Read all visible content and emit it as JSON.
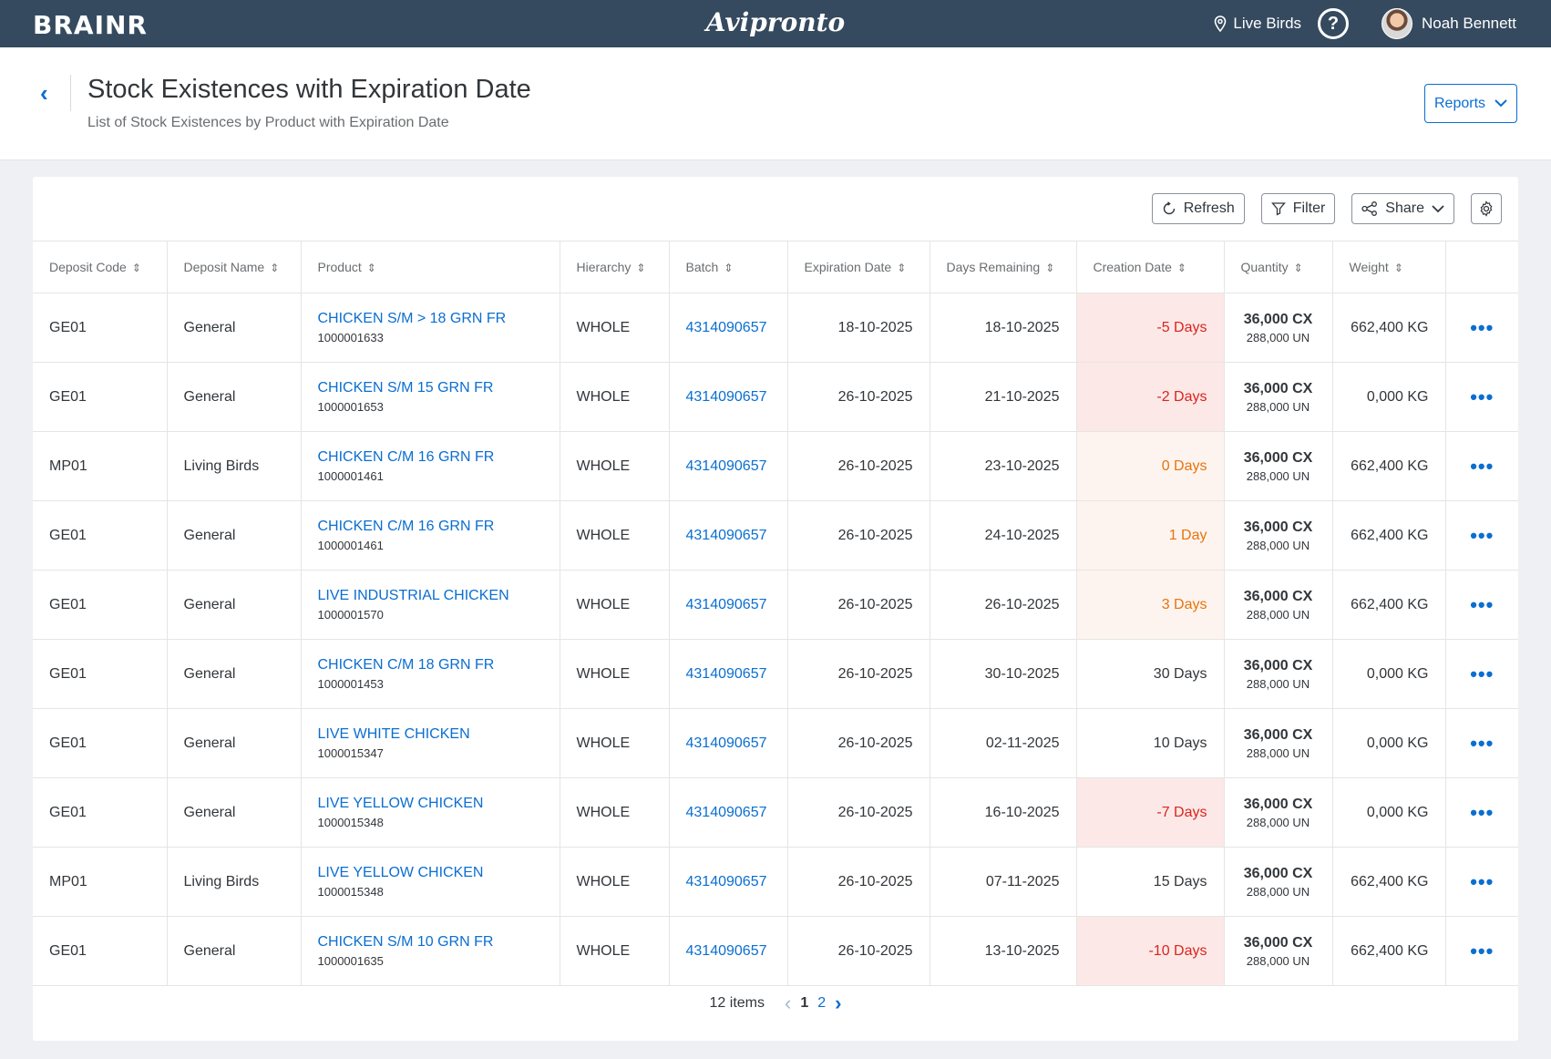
{
  "topbar": {
    "brand": "BRAINR",
    "logo": "Avipronto",
    "location": "Live Birds",
    "help": "?",
    "user_name": "Noah Bennett"
  },
  "header": {
    "back": "‹",
    "title": "Stock Existences with Expiration Date",
    "subtitle": "List of Stock Existences by Product with Expiration Date",
    "reports_label": "Reports"
  },
  "toolbar": {
    "refresh_label": "Refresh",
    "filter_label": "Filter",
    "share_label": "Share"
  },
  "columns": [
    "Deposit Code",
    "Deposit Name",
    "Product",
    "Hierarchy",
    "Batch",
    "Expiration Date",
    "Days Remaining",
    "Creation Date",
    "Quantity",
    "Weight"
  ],
  "rows": [
    {
      "code": "GE01",
      "name": "General",
      "product": "CHICKEN S/M > 18 GRN FR",
      "product_code": "1000001633",
      "hierarchy": "WHOLE",
      "batch": "4314090657",
      "expiration": "18-10-2025",
      "days_remaining": "18-10-2025",
      "creation": "-5 Days",
      "status": "neg",
      "qty": "36,000 CX",
      "qty_un": "288,000 UN",
      "weight": "662,400 KG"
    },
    {
      "code": "GE01",
      "name": "General",
      "product": "CHICKEN S/M 15 GRN FR",
      "product_code": "1000001653",
      "hierarchy": "WHOLE",
      "batch": "4314090657",
      "expiration": "26-10-2025",
      "days_remaining": "21-10-2025",
      "creation": "-2 Days",
      "status": "neg",
      "qty": "36,000 CX",
      "qty_un": "288,000 UN",
      "weight": "0,000 KG"
    },
    {
      "code": "MP01",
      "name": "Living Birds",
      "product": "CHICKEN C/M 16 GRN FR",
      "product_code": "1000001461",
      "hierarchy": "WHOLE",
      "batch": "4314090657",
      "expiration": "26-10-2025",
      "days_remaining": "23-10-2025",
      "creation": "0 Days",
      "status": "warn",
      "qty": "36,000 CX",
      "qty_un": "288,000 UN",
      "weight": "662,400 KG"
    },
    {
      "code": "GE01",
      "name": "General",
      "product": "CHICKEN C/M 16 GRN FR",
      "product_code": "1000001461",
      "hierarchy": "WHOLE",
      "batch": "4314090657",
      "expiration": "26-10-2025",
      "days_remaining": "24-10-2025",
      "creation": "1 Day",
      "status": "warn",
      "qty": "36,000 CX",
      "qty_un": "288,000 UN",
      "weight": "662,400 KG"
    },
    {
      "code": "GE01",
      "name": "General",
      "product": "LIVE INDUSTRIAL CHICKEN",
      "product_code": "1000001570",
      "hierarchy": "WHOLE",
      "batch": "4314090657",
      "expiration": "26-10-2025",
      "days_remaining": "26-10-2025",
      "creation": "3 Days",
      "status": "warn",
      "qty": "36,000 CX",
      "qty_un": "288,000 UN",
      "weight": "662,400 KG"
    },
    {
      "code": "GE01",
      "name": "General",
      "product": "CHICKEN C/M 18 GRN FR",
      "product_code": "1000001453",
      "hierarchy": "WHOLE",
      "batch": "4314090657",
      "expiration": "26-10-2025",
      "days_remaining": "30-10-2025",
      "creation": "30 Days",
      "status": "ok",
      "qty": "36,000 CX",
      "qty_un": "288,000 UN",
      "weight": "0,000 KG"
    },
    {
      "code": "GE01",
      "name": "General",
      "product": "LIVE WHITE CHICKEN",
      "product_code": "1000015347",
      "hierarchy": "WHOLE",
      "batch": "4314090657",
      "expiration": "26-10-2025",
      "days_remaining": "02-11-2025",
      "creation": "10 Days",
      "status": "ok",
      "qty": "36,000 CX",
      "qty_un": "288,000 UN",
      "weight": "0,000 KG"
    },
    {
      "code": "GE01",
      "name": "General",
      "product": "LIVE YELLOW CHICKEN",
      "product_code": "1000015348",
      "hierarchy": "WHOLE",
      "batch": "4314090657",
      "expiration": "26-10-2025",
      "days_remaining": "16-10-2025",
      "creation": "-7 Days",
      "status": "neg",
      "qty": "36,000 CX",
      "qty_un": "288,000 UN",
      "weight": "0,000 KG"
    },
    {
      "code": "MP01",
      "name": "Living Birds",
      "product": "LIVE YELLOW CHICKEN",
      "product_code": "1000015348",
      "hierarchy": "WHOLE",
      "batch": "4314090657",
      "expiration": "26-10-2025",
      "days_remaining": "07-11-2025",
      "creation": "15 Days",
      "status": "ok",
      "qty": "36,000 CX",
      "qty_un": "288,000 UN",
      "weight": "662,400 KG"
    },
    {
      "code": "GE01",
      "name": "General",
      "product": "CHICKEN S/M 10 GRN FR",
      "product_code": "1000001635",
      "hierarchy": "WHOLE",
      "batch": "4314090657",
      "expiration": "26-10-2025",
      "days_remaining": "13-10-2025",
      "creation": "-10 Days",
      "status": "neg",
      "qty": "36,000 CX",
      "qty_un": "288,000 UN",
      "weight": "662,400 KG"
    }
  ],
  "row_action": "•••",
  "pagination": {
    "items": "12 items",
    "prev": "‹",
    "pages": [
      "1",
      "2"
    ],
    "next": "›"
  },
  "colors": {
    "topbar": "#354a5f",
    "link": "#0a6ed1",
    "negative": "#d9251b",
    "negative_bg": "#fde8e8",
    "warning": "#e9730c",
    "warning_bg": "#fdf4ef"
  }
}
